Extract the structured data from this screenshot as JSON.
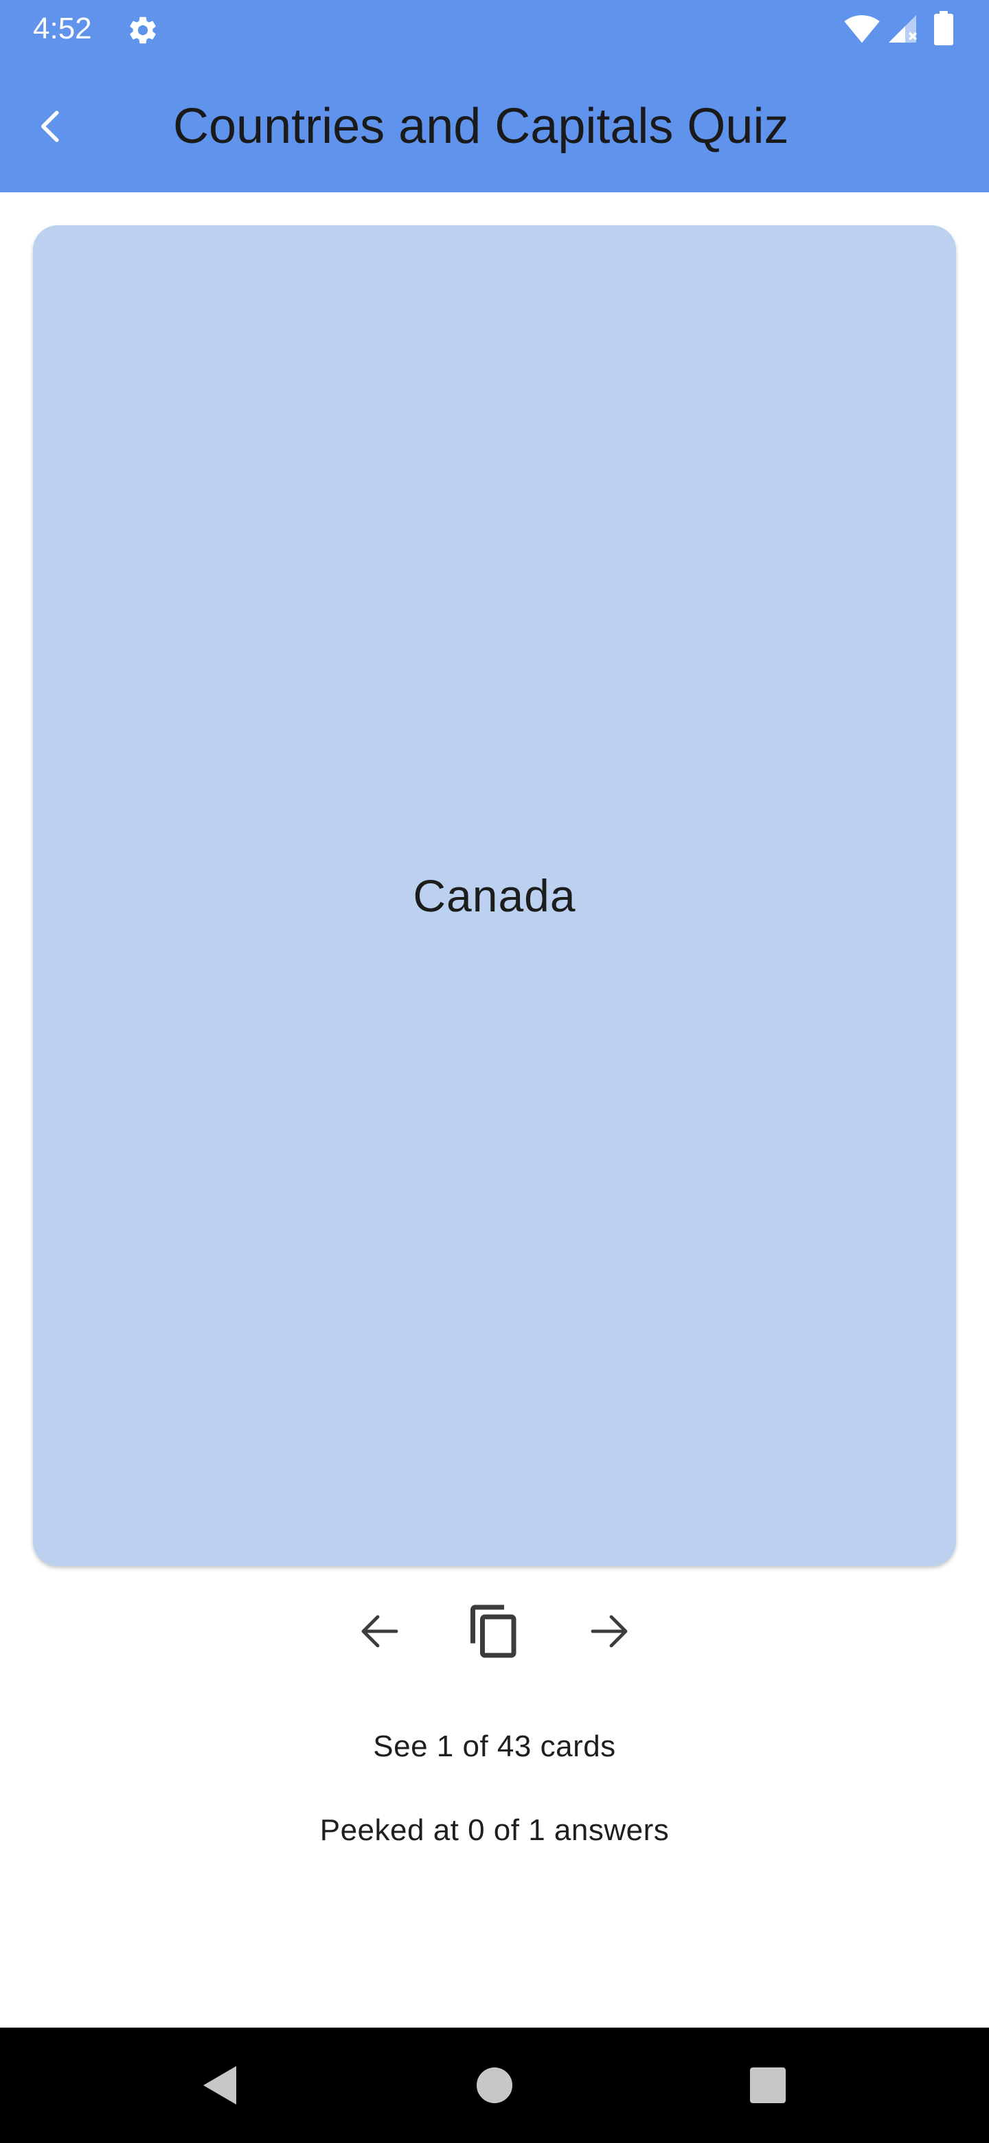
{
  "status_bar": {
    "time": "4:52",
    "icons": [
      "settings-icon",
      "wifi-icon",
      "signal-icon",
      "battery-icon"
    ]
  },
  "header": {
    "title": "Countries and Capitals Quiz",
    "back_icon": "chevron-left-icon"
  },
  "card": {
    "text": "Canada"
  },
  "controls": {
    "previous_icon": "arrow-left-icon",
    "flip_icon": "copy-cards-icon",
    "next_icon": "arrow-right-icon"
  },
  "progress": {
    "seen_text": "See 1 of 43 cards",
    "peeked_text": "Peeked at 0 of 1 answers"
  },
  "nav_bar": {
    "icons": [
      "back-triangle-icon",
      "home-circle-icon",
      "recents-square-icon"
    ]
  },
  "colors": {
    "header": "#6093EC",
    "card": "#BCD1F0",
    "nav_bar": "#000000"
  }
}
